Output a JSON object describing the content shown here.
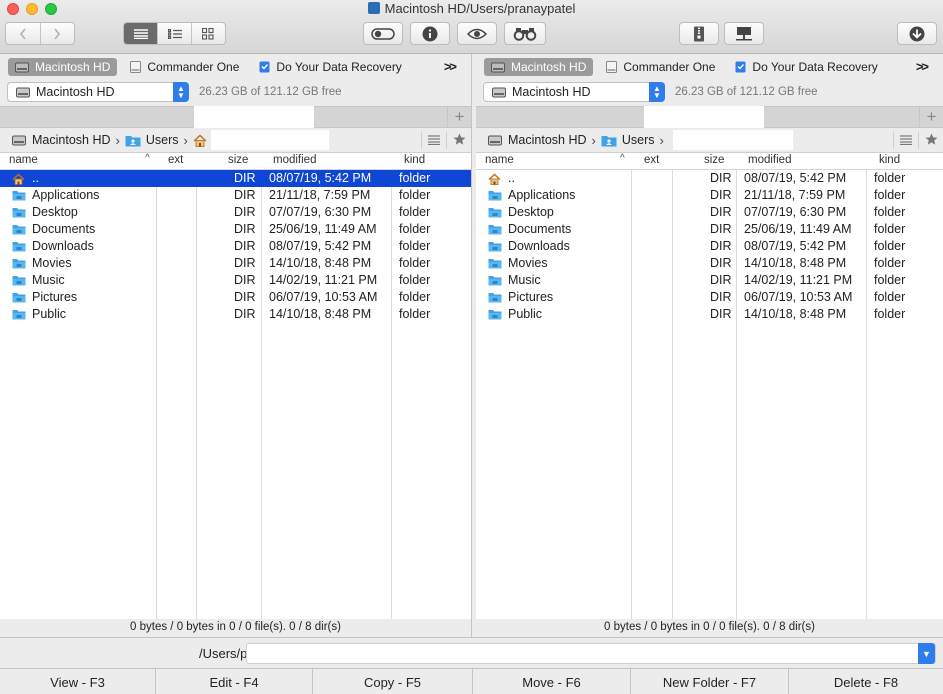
{
  "window": {
    "title": "Macintosh HD/Users/pranaypatel"
  },
  "toolbar": {
    "back_icon": "chevron-left-icon",
    "forward_icon": "chevron-right-icon",
    "view_modes": [
      "list-view-icon",
      "details-view-icon",
      "icon-view-icon"
    ],
    "active_view": 0,
    "buttons": [
      "toggle-hidden-icon",
      "info-icon",
      "preview-eye-icon",
      "search-binoculars-icon",
      "archive-icon",
      "network-drive-icon",
      "download-icon"
    ]
  },
  "left": {
    "favorites": [
      {
        "label": "Macintosh HD",
        "active": true
      },
      {
        "label": "Commander One",
        "active": false
      },
      {
        "label": "Do Your Data Recovery",
        "active": false
      }
    ],
    "more": ">>",
    "volume": {
      "name": "Macintosh HD",
      "info": "26.23 GB of 121.12 GB free"
    },
    "path": [
      "Macintosh HD",
      "Users"
    ],
    "columns": {
      "name": "name",
      "ext": "ext",
      "size": "size",
      "modified": "modified",
      "kind": "kind"
    },
    "rows": [
      {
        "name": "..",
        "ext": "",
        "size": "DIR",
        "modified": "08/07/19, 5:42 PM",
        "kind": "folder",
        "icon": "home-icon",
        "selected": true
      },
      {
        "name": "Applications",
        "ext": "",
        "size": "DIR",
        "modified": "21/11/18, 7:59 PM",
        "kind": "folder",
        "icon": "folder-icon",
        "selected": false
      },
      {
        "name": "Desktop",
        "ext": "",
        "size": "DIR",
        "modified": "07/07/19, 6:30 PM",
        "kind": "folder",
        "icon": "folder-icon",
        "selected": false
      },
      {
        "name": "Documents",
        "ext": "",
        "size": "DIR",
        "modified": "25/06/19, 11:49 AM",
        "kind": "folder",
        "icon": "folder-icon",
        "selected": false
      },
      {
        "name": "Downloads",
        "ext": "",
        "size": "DIR",
        "modified": "08/07/19, 5:42 PM",
        "kind": "folder",
        "icon": "folder-icon",
        "selected": false
      },
      {
        "name": "Movies",
        "ext": "",
        "size": "DIR",
        "modified": "14/10/18, 8:48 PM",
        "kind": "folder",
        "icon": "folder-icon",
        "selected": false
      },
      {
        "name": "Music",
        "ext": "",
        "size": "DIR",
        "modified": "14/02/19, 11:21 PM",
        "kind": "folder",
        "icon": "folder-icon",
        "selected": false
      },
      {
        "name": "Pictures",
        "ext": "",
        "size": "DIR",
        "modified": "06/07/19, 10:53 AM",
        "kind": "folder",
        "icon": "folder-icon",
        "selected": false
      },
      {
        "name": "Public",
        "ext": "",
        "size": "DIR",
        "modified": "14/10/18, 8:48 PM",
        "kind": "folder",
        "icon": "folder-icon",
        "selected": false
      }
    ],
    "status": "0 bytes / 0 bytes in 0 / 0 file(s). 0 / 8 dir(s)"
  },
  "right": {
    "favorites": [
      {
        "label": "Macintosh HD",
        "active": true
      },
      {
        "label": "Commander One",
        "active": false
      },
      {
        "label": "Do Your Data Recovery",
        "active": false
      }
    ],
    "more": ">>",
    "volume": {
      "name": "Macintosh HD",
      "info": "26.23 GB of 121.12 GB free"
    },
    "path": [
      "Macintosh HD",
      "Users"
    ],
    "columns": {
      "name": "name",
      "ext": "ext",
      "size": "size",
      "modified": "modified",
      "kind": "kind"
    },
    "rows": [
      {
        "name": "..",
        "ext": "",
        "size": "DIR",
        "modified": "08/07/19, 5:42 PM",
        "kind": "folder",
        "icon": "home-icon",
        "selected": false
      },
      {
        "name": "Applications",
        "ext": "",
        "size": "DIR",
        "modified": "21/11/18, 7:59 PM",
        "kind": "folder",
        "icon": "folder-icon",
        "selected": false
      },
      {
        "name": "Desktop",
        "ext": "",
        "size": "DIR",
        "modified": "07/07/19, 6:30 PM",
        "kind": "folder",
        "icon": "folder-icon",
        "selected": false
      },
      {
        "name": "Documents",
        "ext": "",
        "size": "DIR",
        "modified": "25/06/19, 11:49 AM",
        "kind": "folder",
        "icon": "folder-icon",
        "selected": false
      },
      {
        "name": "Downloads",
        "ext": "",
        "size": "DIR",
        "modified": "08/07/19, 5:42 PM",
        "kind": "folder",
        "icon": "folder-icon",
        "selected": false
      },
      {
        "name": "Movies",
        "ext": "",
        "size": "DIR",
        "modified": "14/10/18, 8:48 PM",
        "kind": "folder",
        "icon": "folder-icon",
        "selected": false
      },
      {
        "name": "Music",
        "ext": "",
        "size": "DIR",
        "modified": "14/02/19, 11:21 PM",
        "kind": "folder",
        "icon": "folder-icon",
        "selected": false
      },
      {
        "name": "Pictures",
        "ext": "",
        "size": "DIR",
        "modified": "06/07/19, 10:53 AM",
        "kind": "folder",
        "icon": "folder-icon",
        "selected": false
      },
      {
        "name": "Public",
        "ext": "",
        "size": "DIR",
        "modified": "14/10/18, 8:48 PM",
        "kind": "folder",
        "icon": "folder-icon",
        "selected": false
      }
    ],
    "status": "0 bytes / 0 bytes in 0 / 0 file(s). 0 / 8 dir(s)"
  },
  "command": {
    "path": "/Users/p"
  },
  "fkeys": [
    "View - F3",
    "Edit - F4",
    "Copy - F5",
    "Move - F6",
    "New Folder - F7",
    "Delete - F8"
  ],
  "colors": {
    "selection": "#0f46d6",
    "accent": "#2f7dea",
    "folder": "#3ea3e8"
  }
}
